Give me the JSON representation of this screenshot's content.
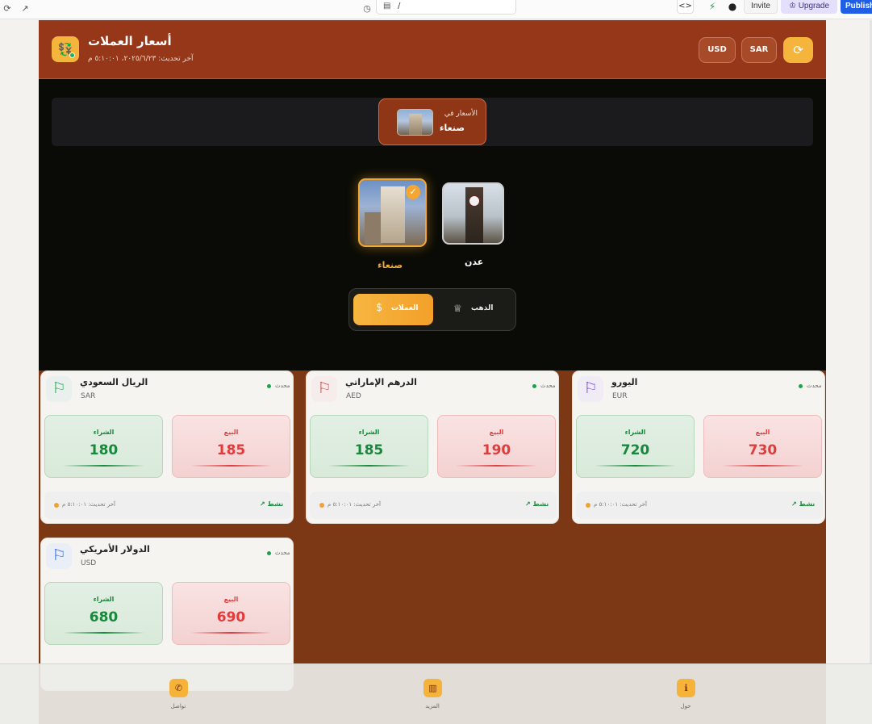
{
  "browser": {
    "url": "/",
    "invite_label": "Invite",
    "upgrade_label": "Upgrade",
    "publish_label": "Publish"
  },
  "header": {
    "title": "أسعار العملات",
    "last_updated": "آخر تحديث: ٢٠٢٥/٦/٢٣، ٥:١٠:٠١ م",
    "usd_label": "USD",
    "sar_label": "SAR"
  },
  "location": {
    "prefix": "الأسعار في",
    "city": "صنعاء"
  },
  "cities": [
    {
      "name": "صنعاء",
      "selected": true
    },
    {
      "name": "عدن",
      "selected": false
    }
  ],
  "tabs": {
    "currencies": "العملات",
    "gold": "الذهب"
  },
  "labels": {
    "buy": "الشراء",
    "sell": "البيع",
    "updated": "محدث",
    "last_update": "آخر تحديث: ٥:١٠:٠١ م",
    "trend": "نشط"
  },
  "currencies": [
    {
      "name": "الريال السعودي",
      "code": "SAR",
      "buy": "180",
      "sell": "185",
      "flag_color": "#19a34a"
    },
    {
      "name": "الدرهم الإماراتي",
      "code": "AED",
      "buy": "185",
      "sell": "190",
      "flag_color": "#e03c3c"
    },
    {
      "name": "اليورو",
      "code": "EUR",
      "buy": "720",
      "sell": "730",
      "flag_color": "#7b3fe4"
    },
    {
      "name": "الدولار الأمريكي",
      "code": "USD",
      "buy": "680",
      "sell": "690",
      "flag_color": "#1f5fe6"
    }
  ],
  "bottom_nav": {
    "contact": "تواصل",
    "more": "المزيد",
    "about": "حول"
  },
  "colors": {
    "brand": "#953718",
    "accent": "#f5b53c",
    "buy": "#18883c",
    "sell": "#e03c3c"
  }
}
